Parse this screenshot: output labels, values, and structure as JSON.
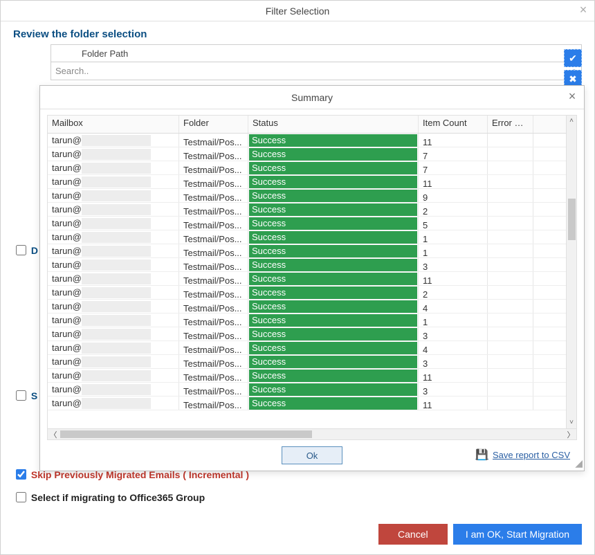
{
  "bg": {
    "title": "Filter Selection",
    "subtitle": "Review the folder selection",
    "folder_header": "Folder Path",
    "search_placeholder": "Search..",
    "check_d": "D",
    "check_s": "S",
    "opt_skip_label": "Skip Previously Migrated Emails ( Incremental )",
    "opt_o365_label": "Select if migrating to Office365 Group",
    "btn_cancel": "Cancel",
    "btn_start": "I am OK, Start Migration"
  },
  "modal": {
    "title": "Summary",
    "columns": {
      "mailbox": "Mailbox",
      "folder": "Folder",
      "status": "Status",
      "item_count": "Item Count",
      "error_det": "Error Det"
    },
    "ok_label": "Ok",
    "csv_label": "Save report to CSV"
  },
  "rows": [
    {
      "mailbox": "tarun@",
      "folder": "Testmail/Pos...",
      "status": "Success",
      "count": "11"
    },
    {
      "mailbox": "tarun@",
      "folder": "Testmail/Pos...",
      "status": "Success",
      "count": "7"
    },
    {
      "mailbox": "tarun@",
      "folder": "Testmail/Pos...",
      "status": "Success",
      "count": "7"
    },
    {
      "mailbox": "tarun@",
      "folder": "Testmail/Pos...",
      "status": "Success",
      "count": "11"
    },
    {
      "mailbox": "tarun@",
      "folder": "Testmail/Pos...",
      "status": "Success",
      "count": "9"
    },
    {
      "mailbox": "tarun@",
      "folder": "Testmail/Pos...",
      "status": "Success",
      "count": "2"
    },
    {
      "mailbox": "tarun@",
      "folder": "Testmail/Pos...",
      "status": "Success",
      "count": "5"
    },
    {
      "mailbox": "tarun@",
      "folder": "Testmail/Pos...",
      "status": "Success",
      "count": "1"
    },
    {
      "mailbox": "tarun@",
      "folder": "Testmail/Pos...",
      "status": "Success",
      "count": "1"
    },
    {
      "mailbox": "tarun@",
      "folder": "Testmail/Pos...",
      "status": "Success",
      "count": "3"
    },
    {
      "mailbox": "tarun@",
      "folder": "Testmail/Pos...",
      "status": "Success",
      "count": "11"
    },
    {
      "mailbox": "tarun@",
      "folder": "Testmail/Pos...",
      "status": "Success",
      "count": "2"
    },
    {
      "mailbox": "tarun@",
      "folder": "Testmail/Pos...",
      "status": "Success",
      "count": "4"
    },
    {
      "mailbox": "tarun@",
      "folder": "Testmail/Pos...",
      "status": "Success",
      "count": "1"
    },
    {
      "mailbox": "tarun@",
      "folder": "Testmail/Pos...",
      "status": "Success",
      "count": "3"
    },
    {
      "mailbox": "tarun@",
      "folder": "Testmail/Pos...",
      "status": "Success",
      "count": "4"
    },
    {
      "mailbox": "tarun@",
      "folder": "Testmail/Pos...",
      "status": "Success",
      "count": "3"
    },
    {
      "mailbox": "tarun@",
      "folder": "Testmail/Pos...",
      "status": "Success",
      "count": "11"
    },
    {
      "mailbox": "tarun@",
      "folder": "Testmail/Pos...",
      "status": "Success",
      "count": "3"
    },
    {
      "mailbox": "tarun@",
      "folder": "Testmail/Pos...",
      "status": "Success",
      "count": "11"
    }
  ]
}
